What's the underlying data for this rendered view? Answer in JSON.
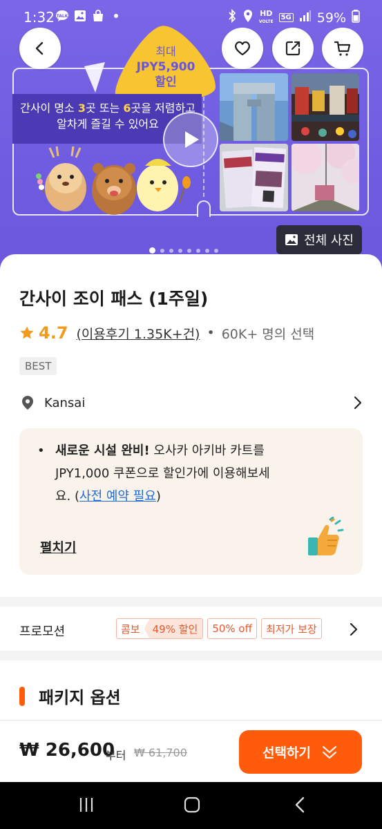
{
  "status_bar": {
    "time": "1:32",
    "notification_icons": [
      "talk-icon",
      "gallery-icon",
      "shopping-bag-icon",
      "dot-icon"
    ],
    "system_icons": [
      "bluetooth-icon",
      "location-icon",
      "hd-voice-icon",
      "5g-icon",
      "signal-icon"
    ],
    "network_labels": [
      "HD",
      "5G"
    ],
    "battery_percent": "59%"
  },
  "hero": {
    "promo_badge": {
      "line1": "최대",
      "line2": "JPY5,900",
      "line3": "할인"
    },
    "tagline_parts": [
      "간사이 명소 ",
      "3",
      "곳 또는 ",
      "6",
      "곳을 저렴하고",
      "알차게 즐길 수 있어요"
    ],
    "all_photos_label": "전체 사진",
    "slide_count": 8,
    "active_slide": 1
  },
  "product": {
    "title": "간사이 조이 패스 (1주일)",
    "rating": "4.7",
    "reviews": "(이용후기 1.35K+건)",
    "separator": "•",
    "picks": "60K+ 명의 선택",
    "badge": "BEST",
    "location": "Kansai"
  },
  "notice": {
    "bullet": "•",
    "bold": "새로운 시설 완비!",
    "text_part1": " 오사카 아키바 카트를 JPY1,000 쿠폰으로 할인가에 이용해보세요. (",
    "link": "사전 예약 필요",
    "text_part2": ")",
    "expand_label": "펼치기"
  },
  "promotion": {
    "label": "프로모션",
    "chip_combo_a": "콤보",
    "chip_combo_b": "49% 할인",
    "chip_off": "50% off",
    "chip_lowest": "최저가 보장"
  },
  "package": {
    "title": "패키지 옵션"
  },
  "bottom": {
    "price": "₩ 26,600",
    "from_label": "부터",
    "original_price": "₩ 61,700",
    "select_label": "선택하기"
  },
  "colors": {
    "accent": "#ff5b0a",
    "hero_purple": "#6f5ce0",
    "rating_star": "#f09b1e",
    "link": "#1e6bd6"
  }
}
